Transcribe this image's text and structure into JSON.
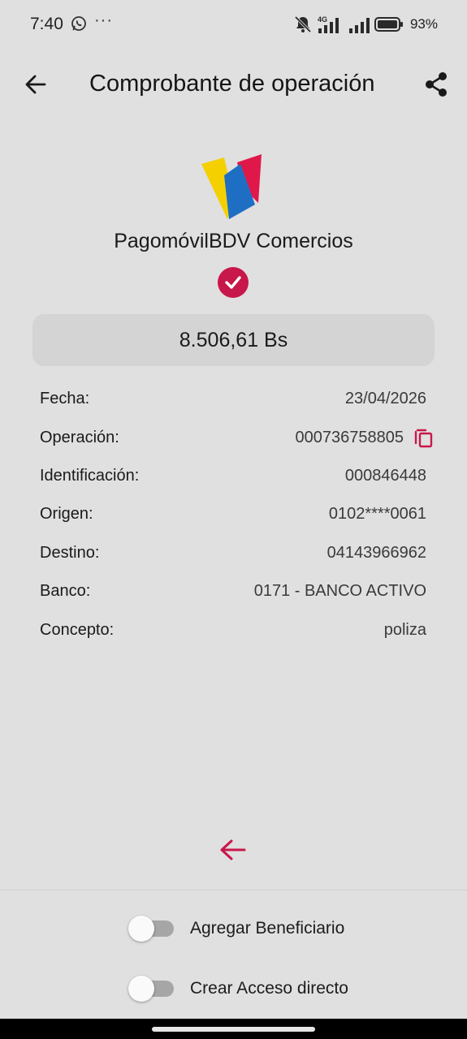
{
  "status_bar": {
    "time": "7:40",
    "icons": [
      "whatsapp-icon",
      "bell-muted-icon",
      "signal-4g-icon",
      "signal-icon",
      "battery-icon"
    ],
    "more": "···",
    "network": "4G",
    "battery": "93%"
  },
  "header": {
    "title": "Comprobante de operación",
    "back_icon": "arrow-left-icon",
    "share_icon": "share-icon"
  },
  "service": {
    "name": "PagomóvilBDV Comercios",
    "status_icon": "check-circle-icon"
  },
  "amount": "8.506,61 Bs",
  "details": [
    {
      "label": "Fecha:",
      "value": "23/04/2026"
    },
    {
      "label": "Operación:",
      "value": "000736758805",
      "action_icon": "copy-icon"
    },
    {
      "label": "Identificación:",
      "value": "000846448"
    },
    {
      "label": "Origen:",
      "value": "0102****0061"
    },
    {
      "label": "Destino:",
      "value": "04143966962"
    },
    {
      "label": "Banco:",
      "value": "0171 - BANCO ACTIVO"
    },
    {
      "label": "Concepto:",
      "value": "poliza"
    }
  ],
  "toggles": [
    {
      "label": "Agregar Beneficiario",
      "on": false
    },
    {
      "label": "Crear Acceso directo",
      "on": false
    }
  ],
  "colors": {
    "background": "#e0e0e0",
    "accent": "#c8174a",
    "amount_box": "#d4d4d4",
    "logo_yellow": "#f5d000",
    "logo_blue": "#1e6fc4",
    "logo_red": "#e0184a"
  }
}
